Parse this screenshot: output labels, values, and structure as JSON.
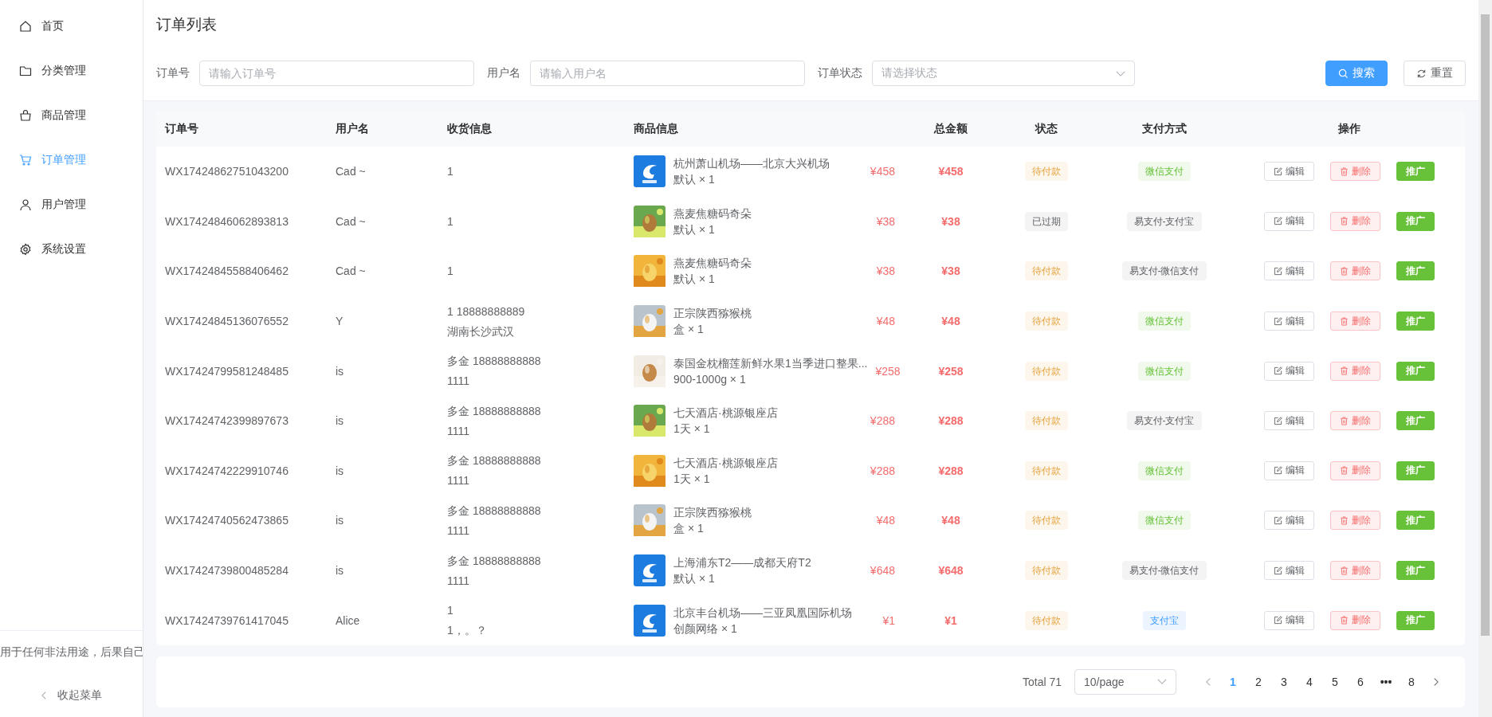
{
  "sidebar": {
    "items": [
      {
        "label": "首页",
        "selected": false
      },
      {
        "label": "分类管理",
        "selected": false
      },
      {
        "label": "商品管理",
        "selected": false
      },
      {
        "label": "订单管理",
        "selected": true
      },
      {
        "label": "用户管理",
        "selected": false
      },
      {
        "label": "系统设置",
        "selected": false
      }
    ],
    "notice": "用于任何非法用途，后果自己",
    "collapse": "收起菜单"
  },
  "page_title": "订单列表",
  "filters": [
    {
      "kind": "input",
      "label": "订单号",
      "placeholder": "请输入订单号"
    },
    {
      "kind": "input",
      "label": "用户名",
      "placeholder": "请输入用户名"
    },
    {
      "kind": "select",
      "label": "订单状态",
      "placeholder": "请选择状态"
    }
  ],
  "buttons": [
    {
      "kind": "primary",
      "label": "搜索"
    },
    {
      "kind": "default",
      "label": "重置"
    }
  ],
  "table": {
    "columns": [
      "订单号",
      "用户名",
      "收货信息",
      "商品信息",
      "总金额",
      "状态",
      "支付方式",
      "操作"
    ],
    "rows": [
      {
        "order_no": "WX17424862751043200",
        "user": "Cad ~",
        "shipping": [
          "1"
        ],
        "product": {
          "kind": "logo",
          "name": "杭州萧山机场——北京大兴机场",
          "spec": "默认 × 1",
          "price": "¥458"
        },
        "total": "¥458",
        "status": {
          "text": "待付款",
          "kind": "warning"
        },
        "payment": {
          "text": "微信支付",
          "kind": "success"
        },
        "actions": [
          "编辑",
          "删除",
          "推广"
        ]
      },
      {
        "order_no": "WX17424846062893813",
        "user": "Cad ~",
        "shipping": [
          "1"
        ],
        "product": {
          "kind": "picture",
          "name": "燕麦焦糖码奇朵",
          "spec": "默认 × 1",
          "price": "¥38"
        },
        "total": "¥38",
        "status": {
          "text": "已过期",
          "kind": "info"
        },
        "payment": {
          "text": "易支付-支付宝",
          "kind": "info"
        },
        "actions": [
          "编辑",
          "删除",
          "推广"
        ]
      },
      {
        "order_no": "WX17424845588406462",
        "user": "Cad ~",
        "shipping": [
          "1"
        ],
        "product": {
          "kind": "picture",
          "name": "燕麦焦糖码奇朵",
          "spec": "默认 × 1",
          "price": "¥38"
        },
        "total": "¥38",
        "status": {
          "text": "待付款",
          "kind": "warning"
        },
        "payment": {
          "text": "易支付-微信支付",
          "kind": "info"
        },
        "actions": [
          "编辑",
          "删除",
          "推广"
        ]
      },
      {
        "order_no": "WX17424845136076552",
        "user": "Y",
        "shipping": [
          "1 18888888889",
          "湖南长沙武汉"
        ],
        "product": {
          "kind": "picture",
          "name": "正宗陕西猕猴桃",
          "spec": "盒 × 1",
          "price": "¥48"
        },
        "total": "¥48",
        "status": {
          "text": "待付款",
          "kind": "warning"
        },
        "payment": {
          "text": "微信支付",
          "kind": "success"
        },
        "actions": [
          "编辑",
          "删除",
          "推广"
        ]
      },
      {
        "order_no": "WX17424799581248485",
        "user": "is",
        "shipping": [
          "多金 18888888888",
          "1111"
        ],
        "product": {
          "kind": "picture",
          "name": "泰国金枕榴莲新鲜水果1当季进口整果...",
          "spec": "900-1000g × 1",
          "price": "¥258"
        },
        "total": "¥258",
        "status": {
          "text": "待付款",
          "kind": "warning"
        },
        "payment": {
          "text": "微信支付",
          "kind": "success"
        },
        "actions": [
          "编辑",
          "删除",
          "推广"
        ]
      },
      {
        "order_no": "WX17424742399897673",
        "user": "is",
        "shipping": [
          "多金 18888888888",
          "1111"
        ],
        "product": {
          "kind": "picture",
          "name": "七天酒店·桃源银座店",
          "spec": "1天 × 1",
          "price": "¥288"
        },
        "total": "¥288",
        "status": {
          "text": "待付款",
          "kind": "warning"
        },
        "payment": {
          "text": "易支付-支付宝",
          "kind": "info"
        },
        "actions": [
          "编辑",
          "删除",
          "推广"
        ]
      },
      {
        "order_no": "WX17424742229910746",
        "user": "is",
        "shipping": [
          "多金 18888888888",
          "1111"
        ],
        "product": {
          "kind": "picture",
          "name": "七天酒店·桃源银座店",
          "spec": "1天 × 1",
          "price": "¥288"
        },
        "total": "¥288",
        "status": {
          "text": "待付款",
          "kind": "warning"
        },
        "payment": {
          "text": "微信支付",
          "kind": "success"
        },
        "actions": [
          "编辑",
          "删除",
          "推广"
        ]
      },
      {
        "order_no": "WX17424740562473865",
        "user": "is",
        "shipping": [
          "多金 18888888888",
          "1111"
        ],
        "product": {
          "kind": "picture",
          "name": "正宗陕西猕猴桃",
          "spec": "盒 × 1",
          "price": "¥48"
        },
        "total": "¥48",
        "status": {
          "text": "待付款",
          "kind": "warning"
        },
        "payment": {
          "text": "微信支付",
          "kind": "success"
        },
        "actions": [
          "编辑",
          "删除",
          "推广"
        ]
      },
      {
        "order_no": "WX17424739800485284",
        "user": "is",
        "shipping": [
          "多金 18888888888",
          "1111"
        ],
        "product": {
          "kind": "logo",
          "name": "上海浦东T2——成都天府T2",
          "spec": "默认 × 1",
          "price": "¥648"
        },
        "total": "¥648",
        "status": {
          "text": "待付款",
          "kind": "warning"
        },
        "payment": {
          "text": "易支付-微信支付",
          "kind": "info"
        },
        "actions": [
          "编辑",
          "删除",
          "推广"
        ]
      },
      {
        "order_no": "WX17424739761417045",
        "user": "Alice",
        "shipping": [
          "1",
          "1，。？"
        ],
        "product": {
          "kind": "logo",
          "name": "北京丰台机场——三亚凤凰国际机场",
          "spec": "创颜网络 × 1",
          "price": "¥1"
        },
        "total": "¥1",
        "status": {
          "text": "待付款",
          "kind": "warning"
        },
        "payment": {
          "text": "支付宝",
          "kind": "primary"
        },
        "actions": [
          "编辑",
          "删除",
          "推广"
        ]
      }
    ]
  },
  "pagination": {
    "total": "Total 71",
    "page_size": "10/page",
    "pages": [
      {
        "label": "1",
        "kind": "page",
        "selected": true
      },
      {
        "label": "2",
        "kind": "page",
        "selected": false
      },
      {
        "label": "3",
        "kind": "page",
        "selected": false
      },
      {
        "label": "4",
        "kind": "page",
        "selected": false
      },
      {
        "label": "5",
        "kind": "page",
        "selected": false
      },
      {
        "label": "6",
        "kind": "page",
        "selected": false
      },
      {
        "label": "•••",
        "kind": "ellipsis",
        "selected": false
      },
      {
        "label": "8",
        "kind": "page",
        "selected": false
      }
    ]
  }
}
